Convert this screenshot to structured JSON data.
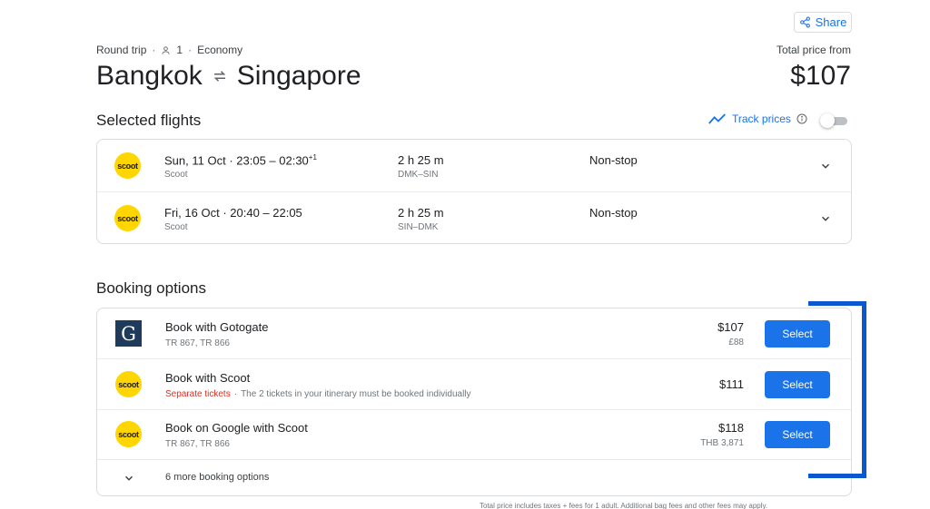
{
  "header": {
    "share_label": "Share",
    "trip_type": "Round trip",
    "passengers": "1",
    "cabin_class": "Economy",
    "origin": "Bangkok",
    "destination": "Singapore",
    "total_label": "Total price from",
    "total_price": "$107"
  },
  "selected_flights": {
    "heading": "Selected flights",
    "track_prices_label": "Track prices",
    "track_prices_enabled": false,
    "flights": [
      {
        "airline_logo_text": "scoot",
        "date": "Sun, 11 Oct",
        "times": "23:05 – 02:30",
        "day_offset": "+1",
        "airline": "Scoot",
        "duration": "2 h 25 m",
        "airports": "DMK–SIN",
        "stops": "Non-stop"
      },
      {
        "airline_logo_text": "scoot",
        "date": "Fri, 16 Oct",
        "times": "20:40 – 22:05",
        "day_offset": "",
        "airline": "Scoot",
        "duration": "2 h 25 m",
        "airports": "SIN–DMK",
        "stops": "Non-stop"
      }
    ]
  },
  "booking_options": {
    "heading": "Booking options",
    "options": [
      {
        "provider_logo": "G",
        "name": "Book with Gotogate",
        "sub": "TR 867, TR 866",
        "price": "$107",
        "alt_price": "£88",
        "select_label": "Select"
      },
      {
        "provider_logo": "scoot",
        "name": "Book with Scoot",
        "warning": "Separate tickets",
        "sub": "The 2 tickets in your itinerary must be booked individually",
        "price": "$111",
        "select_label": "Select"
      },
      {
        "provider_logo": "scoot",
        "name": "Book on Google with Scoot",
        "sub": "TR 867, TR 866",
        "price": "$118",
        "alt_price": "THB 3,871",
        "select_label": "Select"
      }
    ],
    "more_label": "6 more booking options"
  },
  "footnote": "Total price includes taxes + fees for 1 adult. Additional bag fees and other fees may apply.",
  "colors": {
    "accent": "#1a73e8",
    "scoot_yellow": "#ffd602",
    "gotogate_navy": "#1f3b5c",
    "warning": "#d93025",
    "highlight": "#0b57d0"
  }
}
